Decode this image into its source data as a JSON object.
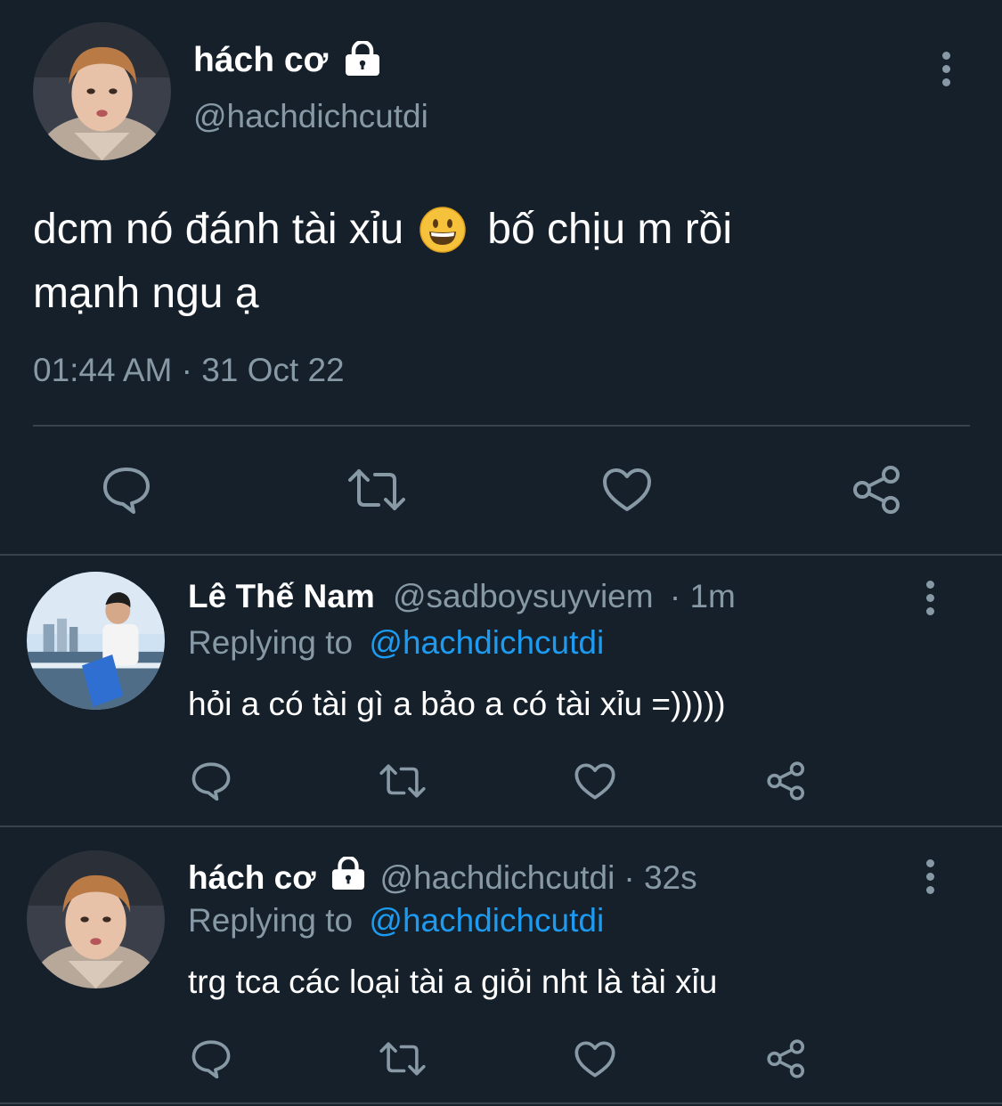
{
  "main_tweet": {
    "author_name": "hách cơ",
    "author_handle": "@hachdichcutdi",
    "text_line1_a": "dcm nó đánh tài xỉu",
    "text_line1_b": "bố chịu m rồi",
    "text_line2": "mạnh ngu ạ",
    "emoji_icon": "grinning-face-icon",
    "timestamp": "01:44 AM · 31 Oct 22",
    "actions": [
      "reply-icon",
      "retweet-icon",
      "like-icon",
      "share-icon"
    ]
  },
  "replies": [
    {
      "author_name": "Lê Thế Nam",
      "author_handle": "@sadboysuyviem",
      "time": "· 1m",
      "replying_prefix": "Replying to",
      "replying_handle": "@hachdichcutdi",
      "text": "hỏi a có tài gì a bảo a có tài xỉu =)))))",
      "protected": false
    },
    {
      "author_name": "hách cơ",
      "author_handle": "@hachdichcutdi",
      "time": "· 32s",
      "replying_prefix": "Replying to",
      "replying_handle": "@hachdichcutdi",
      "text": "trg tca các loại tài a giỏi nht là tài xỉu",
      "protected": true
    }
  ],
  "colors": {
    "background": "#15202b",
    "text": "#ffffff",
    "muted": "#8899a6",
    "link": "#1d9bf0",
    "divider": "#38444d"
  }
}
